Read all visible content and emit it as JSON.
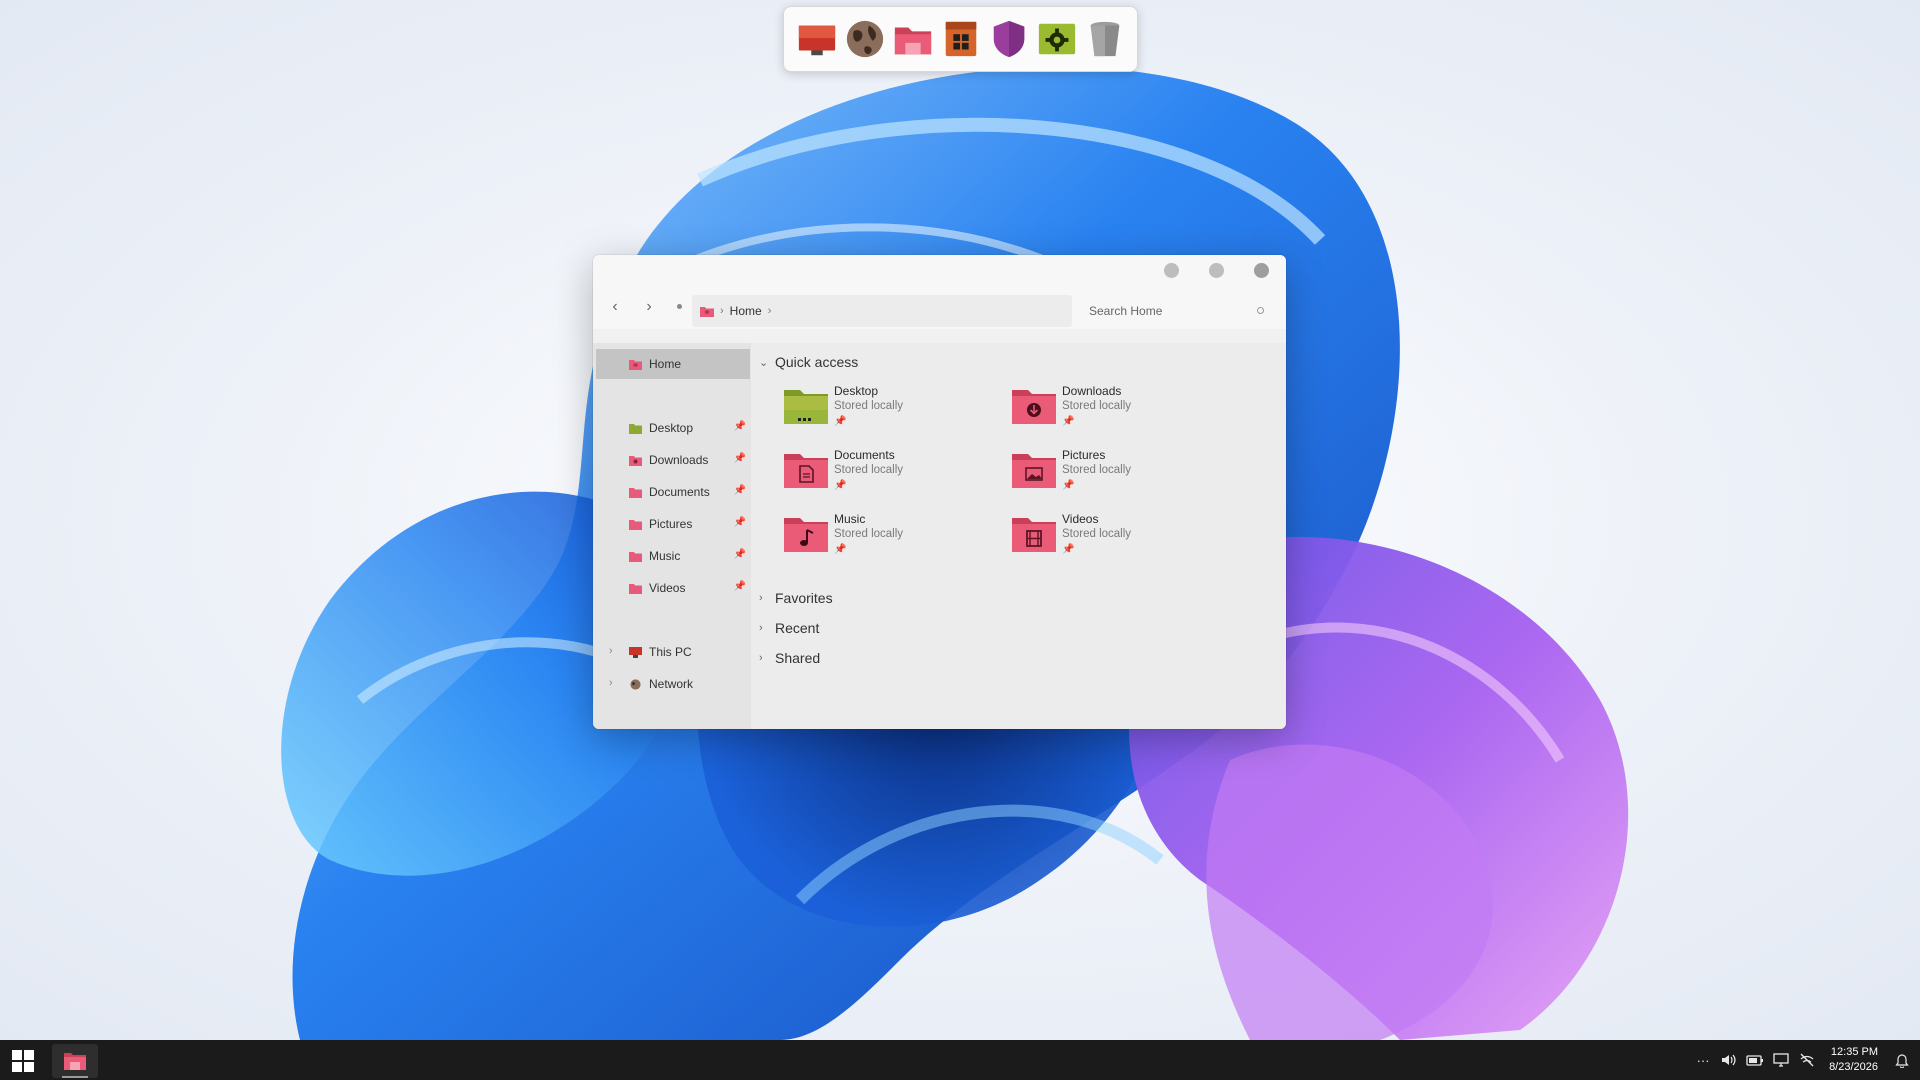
{
  "desktop": {
    "dock": {
      "items": [
        {
          "name": "This PC",
          "icon": "monitor-icon"
        },
        {
          "name": "Network",
          "icon": "globe-icon"
        },
        {
          "name": "File Explorer",
          "icon": "folder-icon"
        },
        {
          "name": "Windows Store",
          "icon": "store-icon"
        },
        {
          "name": "Security",
          "icon": "shield-icon"
        },
        {
          "name": "Settings",
          "icon": "gear-icon"
        },
        {
          "name": "Recycle Bin",
          "icon": "trash-icon"
        }
      ]
    }
  },
  "explorer": {
    "breadcrumb": {
      "location": "Home",
      "separator": "›"
    },
    "search": {
      "placeholder": "Search Home"
    },
    "sidebar": {
      "home": {
        "label": "Home",
        "icon": "home-folder-icon"
      },
      "pinned": [
        {
          "label": "Desktop",
          "icon": "desktop-folder-icon"
        },
        {
          "label": "Downloads",
          "icon": "downloads-folder-icon"
        },
        {
          "label": "Documents",
          "icon": "documents-folder-icon"
        },
        {
          "label": "Pictures",
          "icon": "pictures-folder-icon"
        },
        {
          "label": "Music",
          "icon": "music-folder-icon"
        },
        {
          "label": "Videos",
          "icon": "videos-folder-icon"
        }
      ],
      "locations": [
        {
          "label": "This PC",
          "icon": "monitor-icon"
        },
        {
          "label": "Network",
          "icon": "globe-icon"
        }
      ]
    },
    "quick_access": {
      "title": "Quick access",
      "items": [
        {
          "name": "Desktop",
          "status": "Stored locally",
          "icon": "desktop-folder-icon"
        },
        {
          "name": "Downloads",
          "status": "Stored locally",
          "icon": "downloads-folder-icon"
        },
        {
          "name": "Documents",
          "status": "Stored locally",
          "icon": "documents-folder-icon"
        },
        {
          "name": "Pictures",
          "status": "Stored locally",
          "icon": "pictures-folder-icon"
        },
        {
          "name": "Music",
          "status": "Stored locally",
          "icon": "music-folder-icon"
        },
        {
          "name": "Videos",
          "status": "Stored locally",
          "icon": "videos-folder-icon"
        }
      ]
    },
    "sections": {
      "favorites": "Favorites",
      "recent": "Recent",
      "shared": "Shared"
    },
    "pin_glyph": "📌"
  },
  "taskbar": {
    "clock": {
      "time": "12:35 PM",
      "date": "8/23/2026"
    },
    "tray_overflow": "···"
  },
  "colors": {
    "folder_pink": "#e85a7a",
    "folder_green": "#8ea834",
    "taskbar_bg": "#1b1b1b"
  }
}
